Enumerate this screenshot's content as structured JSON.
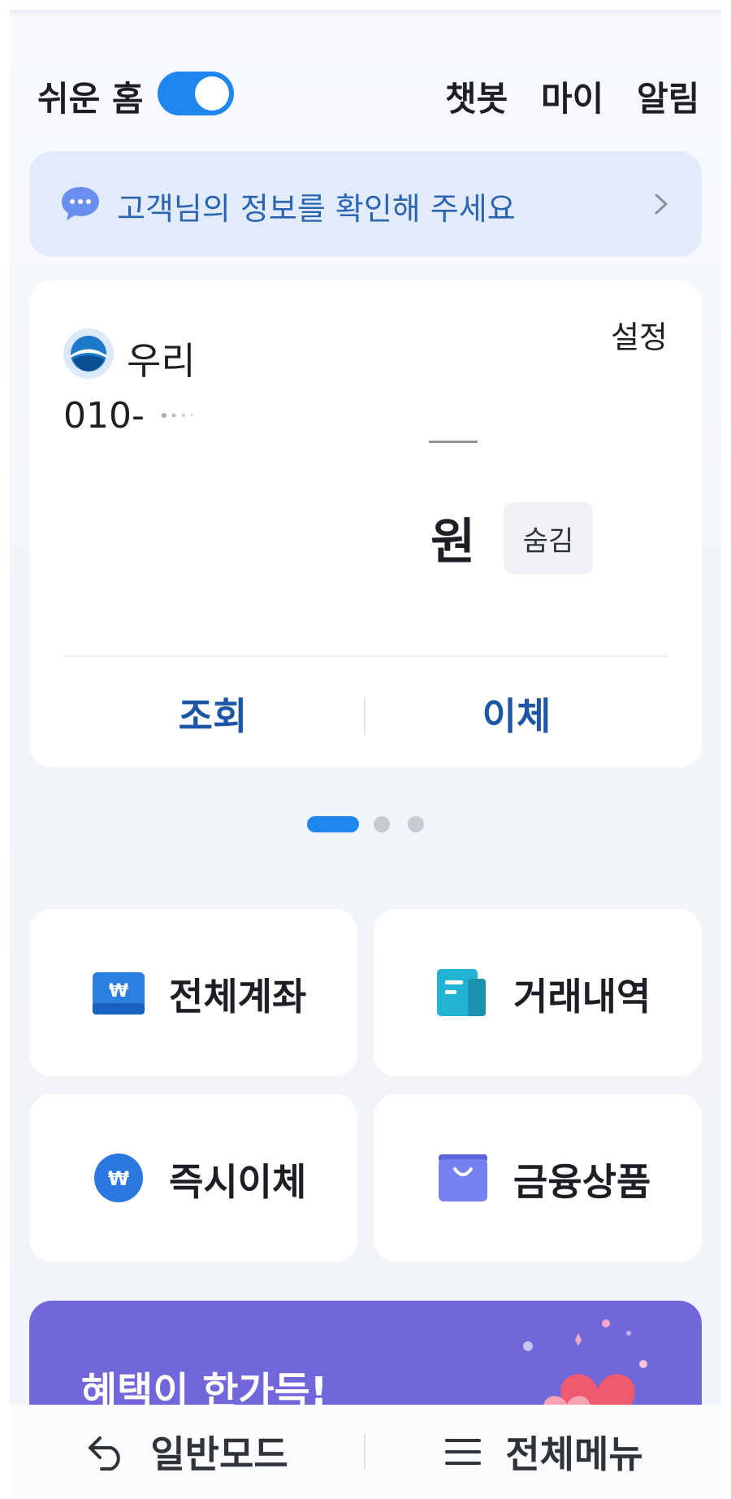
{
  "header": {
    "easy_home_label": "쉬운 홈",
    "easy_home_toggle": "on",
    "chatbot": "챗봇",
    "my": "마이",
    "alarm": "알림"
  },
  "notice": {
    "text": "고객님의 정보를 확인해 주세요"
  },
  "account_card": {
    "bank_name": "우리",
    "settings": "설정",
    "account_number": "010-",
    "currency_unit": "원",
    "hide_button": "숨김",
    "actions": [
      "조회",
      "이체"
    ]
  },
  "pager": {
    "count": 3,
    "active_index": 0
  },
  "tiles": [
    {
      "label": "전체계좌",
      "icon": "won-wallet-icon"
    },
    {
      "label": "거래내역",
      "icon": "document-icon"
    },
    {
      "label": "즉시이체",
      "icon": "won-coin-icon"
    },
    {
      "label": "금융상품",
      "icon": "shopping-bag-icon"
    }
  ],
  "banner": {
    "text": "혜택이 한가득!"
  },
  "bottom_bar": {
    "normal_mode": "일반모드",
    "full_menu": "전체메뉴"
  },
  "colors": {
    "accent": "#1f86ee",
    "action_text": "#1c56a5",
    "notice_bg": "#e1ebf9",
    "banner_bg": "#7266db"
  }
}
